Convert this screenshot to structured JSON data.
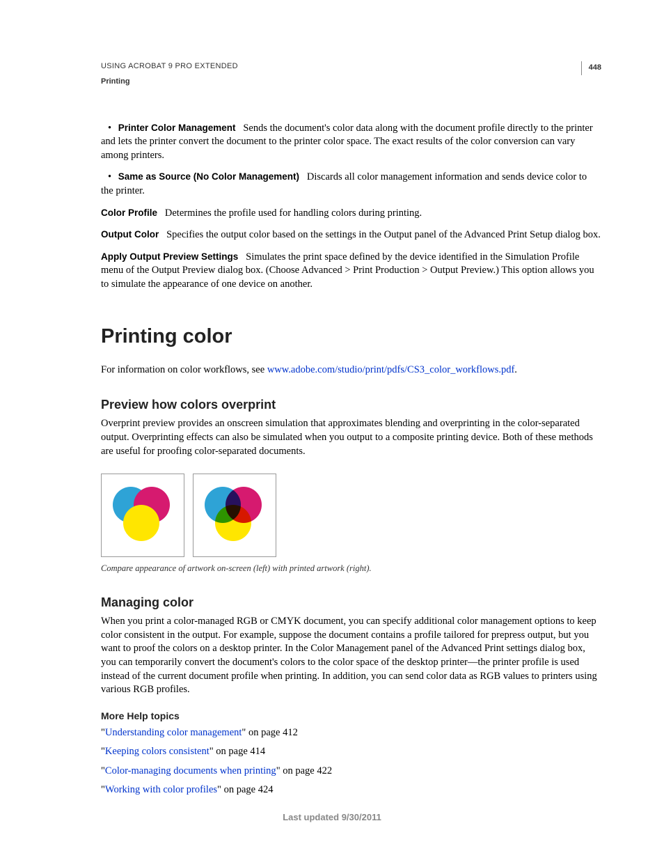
{
  "header": {
    "doc_title": "USING ACROBAT 9 PRO EXTENDED",
    "breadcrumb": "Printing",
    "page_number": "448"
  },
  "intro": {
    "b1_term": "Printer Color Management",
    "b1_text": "Sends the document's color data along with the document profile directly to the printer and lets the printer convert the document to the printer color space. The exact results of the color conversion can vary among printers.",
    "b2_term": "Same as Source (No Color Management)",
    "b2_text": "Discards all color management information and sends device color to the printer.",
    "d1_term": "Color Profile",
    "d1_text": "Determines the profile used for handling colors during printing.",
    "d2_term": "Output Color",
    "d2_text": "Specifies the output color based on the settings in the Output panel of the Advanced Print Setup dialog box.",
    "d3_term": "Apply Output Preview Settings",
    "d3_text": "Simulates the print space defined by the device identified in the Simulation Profile menu of the Output Preview dialog box. (Choose Advanced > Print Production > Output Preview.) This option allows you to simulate the appearance of one device on another."
  },
  "section": {
    "h1": "Printing color",
    "intro_prefix": "For information on color workflows, see ",
    "intro_link": "www.adobe.com/studio/print/pdfs/CS3_color_workflows.pdf",
    "intro_suffix": ".",
    "h2a": "Preview how colors overprint",
    "p2a": "Overprint preview provides an onscreen simulation that approximates blending and overprinting in the color-separated output. Overprinting effects can also be simulated when you output to a composite printing device. Both of these methods are useful for proofing color-separated documents.",
    "caption": "Compare appearance of artwork on-screen (left) with printed artwork (right).",
    "h2b": "Managing color",
    "p2b": "When you print a color-managed RGB or CMYK document, you can specify additional color management options to keep color consistent in the output. For example, suppose the document contains a profile tailored for prepress output, but you want to proof the colors on a desktop printer. In the Color Management panel of the Advanced Print settings dialog box, you can temporarily convert the document's colors to the color space of the desktop printer—the printer profile is used instead of the current document profile when printing. In addition, you can send color data as RGB values to printers using various RGB profiles.",
    "h3": "More Help topics",
    "help": [
      {
        "link": "Understanding color management",
        "suffix": "\" on page 412"
      },
      {
        "link": "Keeping colors consistent",
        "suffix": "\" on page 414"
      },
      {
        "link": "Color-managing documents when printing",
        "suffix": "\" on page 422"
      },
      {
        "link": "Working with color profiles",
        "suffix": "\" on page 424"
      }
    ]
  },
  "footer": "Last updated 9/30/2011"
}
